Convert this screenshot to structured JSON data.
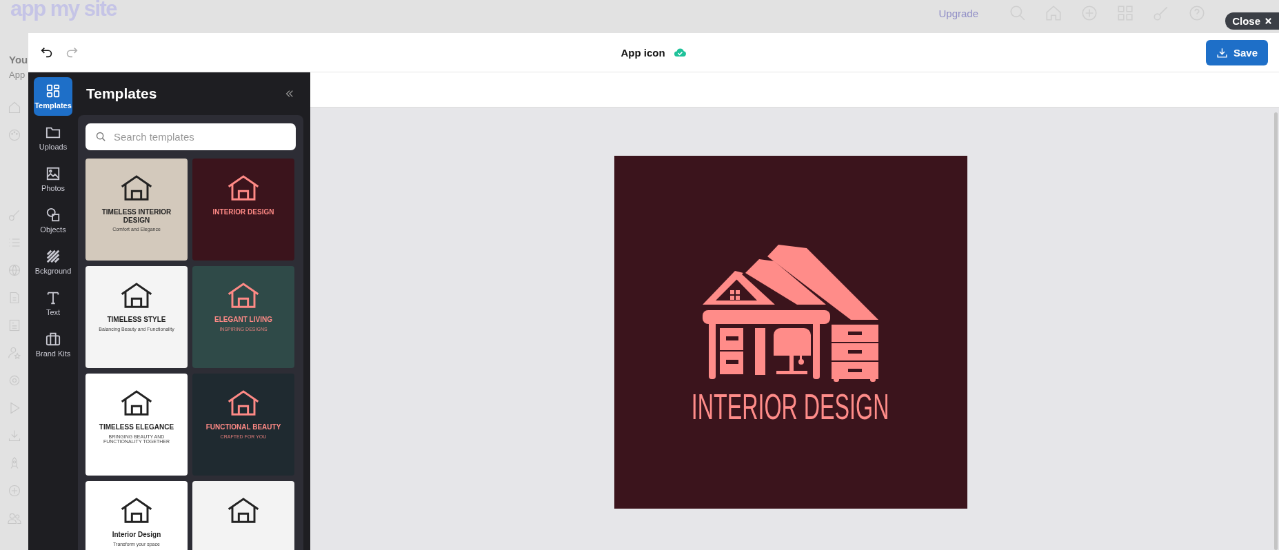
{
  "background": {
    "logo": "app my site",
    "heading": "You",
    "subheading": "App",
    "upgrade": "Upgrade"
  },
  "close_button": {
    "label": "Close"
  },
  "editor": {
    "title": "App icon",
    "saved": true,
    "save_button": "Save",
    "undo_enabled": true,
    "redo_enabled": false
  },
  "rail": [
    {
      "label": "Templates",
      "kind": "templates",
      "selected": true
    },
    {
      "label": "Uploads",
      "kind": "folder",
      "selected": false
    },
    {
      "label": "Photos",
      "kind": "image",
      "selected": false
    },
    {
      "label": "Objects",
      "kind": "shapes",
      "selected": false
    },
    {
      "label": "Bckground",
      "kind": "stripes",
      "selected": false
    },
    {
      "label": "Text",
      "kind": "text",
      "selected": false
    },
    {
      "label": "Brand Kits",
      "kind": "briefcase",
      "selected": false
    }
  ],
  "panel": {
    "title": "Templates",
    "search": {
      "placeholder": "Search templates"
    },
    "templates": [
      {
        "title": "TIMELESS INTERIOR DESIGN",
        "subtitle": "Comfort and Elegance",
        "color": "#d3c9bc"
      },
      {
        "title": "INTERIOR DESIGN",
        "color": "#3b141c"
      },
      {
        "title": "TIMELESS STYLE",
        "subtitle": "Balancing Beauty and Functionality",
        "color": "#f4f4f4"
      },
      {
        "title": "ELEGANT LIVING",
        "subtitle": "INSPIRING DESIGNS",
        "color": "#2f4a48"
      },
      {
        "title": "TIMELESS ELEGANCE",
        "subtitle": "BRINGING BEAUTY AND FUNCTIONALITY TOGETHER",
        "color": "#ffffff"
      },
      {
        "title": "FUNCTIONAL BEAUTY",
        "subtitle": "CRAFTED FOR YOU",
        "color": "#1f2a30"
      },
      {
        "title": "Interior Design",
        "subtitle": "Transform your space",
        "color": "#ffffff"
      },
      {
        "color": "#f3f3f3"
      }
    ]
  },
  "canvas": {
    "title": "INTERIOR DESIGN"
  }
}
